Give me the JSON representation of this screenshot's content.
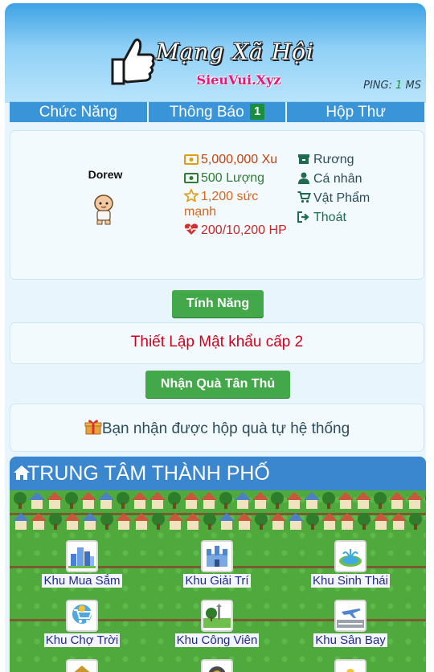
{
  "header": {
    "title": "Mạng Xã Hội",
    "subtitle": "SieuVui.Xyz",
    "ping_label": "PING:",
    "ping_value": "1",
    "ping_unit": "MS"
  },
  "nav": {
    "items": [
      {
        "label": "Chức Năng"
      },
      {
        "label": "Thông Báo",
        "badge": "1"
      },
      {
        "label": "Hộp Thư"
      }
    ]
  },
  "profile": {
    "username": "Dorew",
    "stats": {
      "xu": "5,000,000 Xu",
      "luong": "500 Lượng",
      "power": "1,200 sức mạnh",
      "hp": "200/10,200 HP"
    },
    "menu": [
      {
        "label": "Rương",
        "icon": "chest-icon"
      },
      {
        "label": "Cá nhân",
        "icon": "user-icon"
      },
      {
        "label": "Vật Phẩm",
        "icon": "cart-icon"
      },
      {
        "label": "Thoát",
        "icon": "logout-icon"
      }
    ]
  },
  "buttons": {
    "features": "Tính Năng",
    "second_password": "Thiết Lập Mật khẩu cấp 2",
    "newbie_gift": "Nhận Quà Tân Thủ"
  },
  "gift_message": "Bạn nhận được hộp quà tự hệ thống",
  "city": {
    "title": "TRUNG TÂM THÀNH PHỐ",
    "zones": [
      {
        "label": "Khu Mua Sắm",
        "icon": "city-buildings-icon"
      },
      {
        "label": "Khu Giải Trí",
        "icon": "castle-icon"
      },
      {
        "label": "Khu Sinh Thái",
        "icon": "fountain-icon"
      },
      {
        "label": "Khu Chợ Trời",
        "icon": "market-cart-icon"
      },
      {
        "label": "Khu Công Viên",
        "icon": "park-icon"
      },
      {
        "label": "Khu Sân Bay",
        "icon": "airport-icon"
      }
    ]
  },
  "colors": {
    "nav_bg": "#3a94d8",
    "button_green": "#43a84a",
    "danger_text": "#d0021b",
    "section_header": "#3a86cf"
  }
}
